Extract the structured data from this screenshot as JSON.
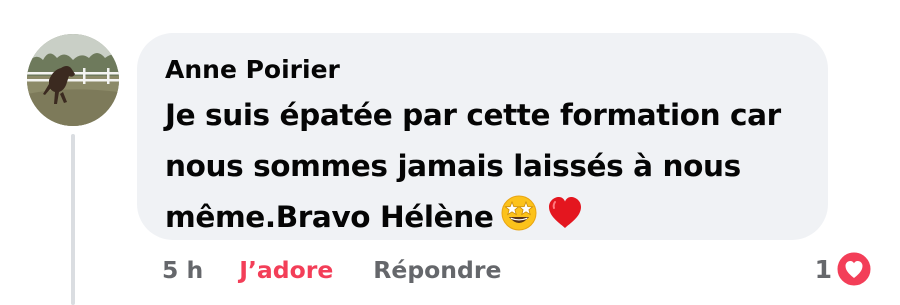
{
  "comment": {
    "author": "Anne Poirier",
    "text": "Je suis épatée par cette formation car nous sommes jamais laissés à nous même.Bravo Hélène",
    "emojis": [
      "star-struck-emoji",
      "red-heart-emoji"
    ],
    "timestamp": "5 h",
    "like_label": "J’adore",
    "reply_label": "Répondre",
    "reaction_count": "1",
    "reaction_type": "love-reaction-icon"
  },
  "colors": {
    "bubble_background": "#f0f2f5",
    "text": "#050505",
    "secondary_text": "#65676b",
    "love_accent": "#f33e58",
    "thread_line": "#dadde1"
  }
}
